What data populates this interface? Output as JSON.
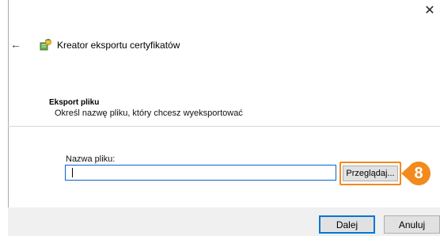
{
  "window": {
    "close_glyph": "✕",
    "back_glyph": "←",
    "title": "Kreator eksportu certyfikatów",
    "title_icon": "certificate-wizard-icon"
  },
  "section": {
    "title": "Eksport pliku",
    "description": "Określ nazwę pliku, który chcesz wyeksportować"
  },
  "file_field": {
    "label": "Nazwa pliku:",
    "value": "",
    "browse_label": "Przeglądaj..."
  },
  "annotation": {
    "step_number": "8",
    "color": "#f28a1e"
  },
  "footer": {
    "next_label": "Dalej",
    "cancel_label": "Anuluj"
  },
  "colors": {
    "accent": "#0078d7",
    "footer_bg": "#f0f0f0",
    "button_bg": "#e1e1e1"
  }
}
